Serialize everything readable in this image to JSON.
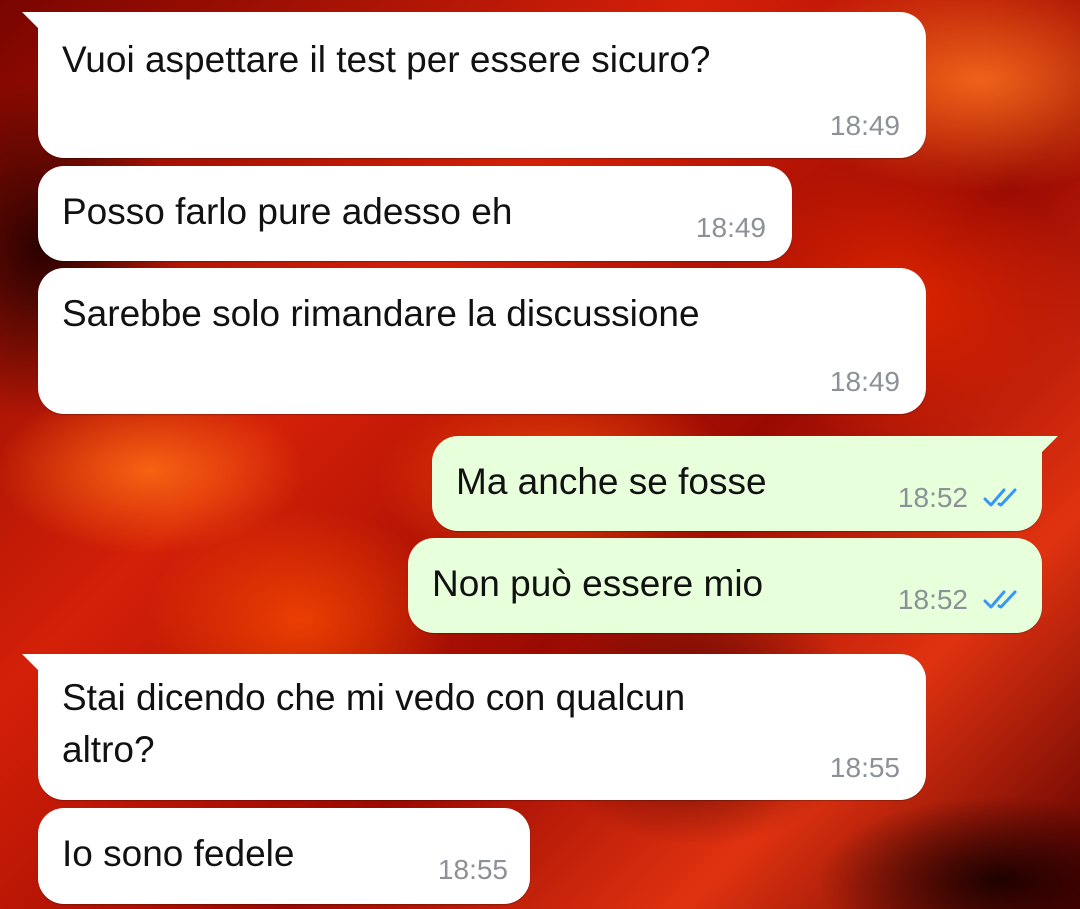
{
  "messages": [
    {
      "direction": "incoming",
      "text": "Vuoi aspettare il test per essere sicuro?",
      "time": "18:49"
    },
    {
      "direction": "incoming",
      "text": "Posso farlo pure adesso eh",
      "time": "18:49"
    },
    {
      "direction": "incoming",
      "text": "Sarebbe solo rimandare la discussione",
      "time": "18:49"
    },
    {
      "direction": "outgoing",
      "text": "Ma anche se fosse",
      "time": "18:52",
      "status": "read"
    },
    {
      "direction": "outgoing",
      "text": "Non può essere mio",
      "time": "18:52",
      "status": "read"
    },
    {
      "direction": "incoming",
      "text": "Stai dicendo che mi vedo con qualcun\naltro?",
      "time": "18:55"
    },
    {
      "direction": "incoming",
      "text": "Io sono fedele",
      "time": "18:55"
    }
  ],
  "colors": {
    "incoming_bubble": "#ffffff",
    "outgoing_bubble": "#e7ffdb",
    "read_ticks": "#3497f9",
    "timestamp": "#8b9196"
  },
  "icons": {
    "read_status": "double-check-icon"
  }
}
